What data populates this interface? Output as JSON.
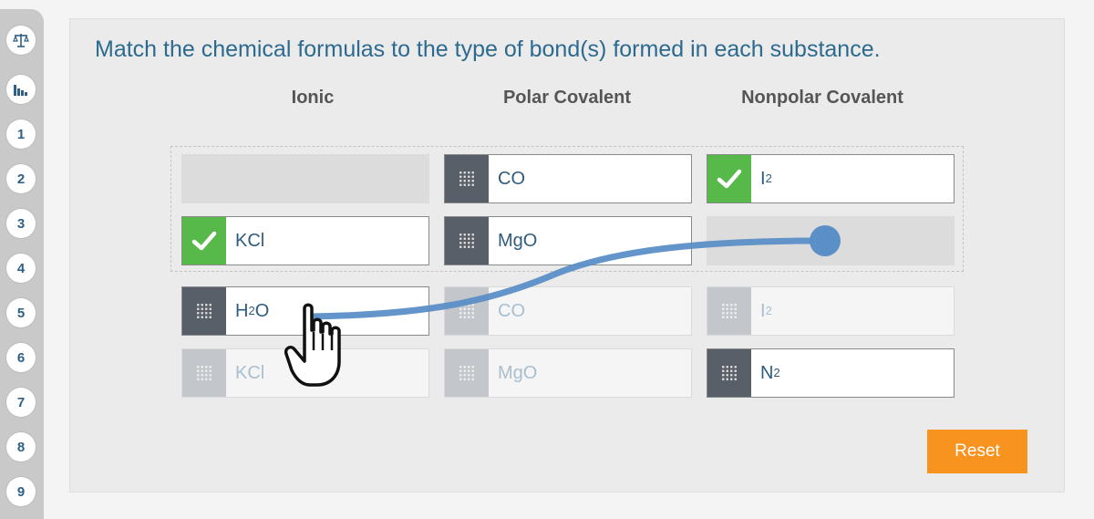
{
  "question": "Match the chemical formulas to the type of bond(s) formed in each substance.",
  "columns": [
    "Ionic",
    "Polar Covalent",
    "Nonpolar Covalent"
  ],
  "nav": {
    "icons": [
      "balance-scale-icon",
      "bar-chart-icon"
    ],
    "items": [
      "1",
      "2",
      "3",
      "4",
      "5",
      "6",
      "7",
      "8",
      "9"
    ]
  },
  "placed": {
    "row1": {
      "ionic": null,
      "polar": {
        "formula": "CO",
        "status": "draggable"
      },
      "nonpolar": {
        "base": "I",
        "sub": "2",
        "status": "correct"
      }
    },
    "row2": {
      "ionic": {
        "formula": "KCl",
        "status": "correct"
      },
      "polar": {
        "formula": "MgO",
        "status": "draggable"
      },
      "nonpolar": null
    }
  },
  "bank": {
    "h2o": {
      "base": "H",
      "sub": "2",
      "rest": "O",
      "status": "being-dragged"
    },
    "kcl": {
      "formula": "KCl",
      "status": "used"
    },
    "co": {
      "formula": "CO",
      "status": "used"
    },
    "mgo": {
      "formula": "MgO",
      "status": "used"
    },
    "i2": {
      "base": "I",
      "sub": "2",
      "status": "used"
    },
    "n2": {
      "base": "N",
      "sub": "2",
      "status": "available"
    }
  },
  "reset_label": "Reset",
  "colors": {
    "title": "#2c6a8f",
    "reset": "#f7931e",
    "correct": "#56b94a",
    "handle": "#585f68",
    "drag_line": "#5b8fc7"
  }
}
